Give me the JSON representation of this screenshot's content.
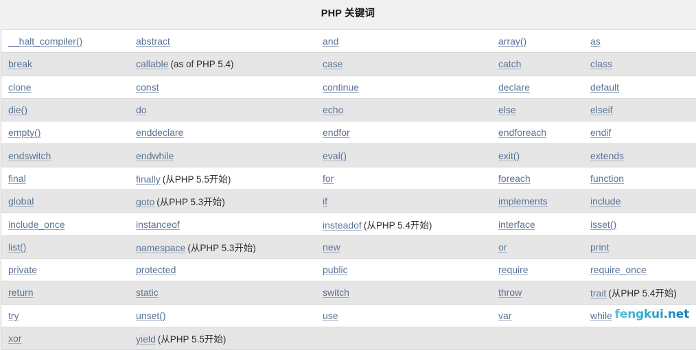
{
  "page": {
    "title": "PHP 关键词",
    "watermark": "fengkui.net",
    "background_color": "#f1f1f1",
    "link_color": "#5b7394",
    "row_alt_color": "#e6e6e6",
    "watermark_color": "#1b8fc4"
  },
  "table": {
    "columns": 5,
    "rows": [
      [
        {
          "keyword": "__halt_compiler()",
          "note": ""
        },
        {
          "keyword": "abstract",
          "note": ""
        },
        {
          "keyword": "and",
          "note": ""
        },
        {
          "keyword": "array()",
          "note": ""
        },
        {
          "keyword": "as",
          "note": ""
        }
      ],
      [
        {
          "keyword": "break",
          "note": ""
        },
        {
          "keyword": "callable",
          "note": "(as of PHP 5.4)"
        },
        {
          "keyword": "case",
          "note": ""
        },
        {
          "keyword": "catch",
          "note": ""
        },
        {
          "keyword": "class",
          "note": ""
        }
      ],
      [
        {
          "keyword": "clone",
          "note": ""
        },
        {
          "keyword": "const",
          "note": ""
        },
        {
          "keyword": "continue",
          "note": ""
        },
        {
          "keyword": "declare",
          "note": ""
        },
        {
          "keyword": "default",
          "note": ""
        }
      ],
      [
        {
          "keyword": "die()",
          "note": ""
        },
        {
          "keyword": "do",
          "note": ""
        },
        {
          "keyword": "echo",
          "note": ""
        },
        {
          "keyword": "else",
          "note": ""
        },
        {
          "keyword": "elseif",
          "note": ""
        }
      ],
      [
        {
          "keyword": "empty()",
          "note": ""
        },
        {
          "keyword": "enddeclare",
          "note": ""
        },
        {
          "keyword": "endfor",
          "note": ""
        },
        {
          "keyword": "endforeach",
          "note": ""
        },
        {
          "keyword": "endif",
          "note": ""
        }
      ],
      [
        {
          "keyword": "endswitch",
          "note": ""
        },
        {
          "keyword": "endwhile",
          "note": ""
        },
        {
          "keyword": "eval()",
          "note": ""
        },
        {
          "keyword": "exit()",
          "note": ""
        },
        {
          "keyword": "extends",
          "note": ""
        }
      ],
      [
        {
          "keyword": "final",
          "note": ""
        },
        {
          "keyword": "finally",
          "note": "(从PHP 5.5开始)"
        },
        {
          "keyword": "for",
          "note": ""
        },
        {
          "keyword": "foreach",
          "note": ""
        },
        {
          "keyword": "function",
          "note": ""
        }
      ],
      [
        {
          "keyword": "global",
          "note": ""
        },
        {
          "keyword": "goto",
          "note": "(从PHP 5.3开始)"
        },
        {
          "keyword": "if",
          "note": ""
        },
        {
          "keyword": "implements",
          "note": ""
        },
        {
          "keyword": "include",
          "note": ""
        }
      ],
      [
        {
          "keyword": "include_once",
          "note": ""
        },
        {
          "keyword": "instanceof",
          "note": ""
        },
        {
          "keyword": "insteadof",
          "note": "(从PHP 5.4开始)"
        },
        {
          "keyword": "interface",
          "note": ""
        },
        {
          "keyword": "isset()",
          "note": ""
        }
      ],
      [
        {
          "keyword": "list()",
          "note": ""
        },
        {
          "keyword": "namespace",
          "note": "(从PHP 5.3开始)"
        },
        {
          "keyword": "new",
          "note": ""
        },
        {
          "keyword": "or",
          "note": ""
        },
        {
          "keyword": "print",
          "note": ""
        }
      ],
      [
        {
          "keyword": "private",
          "note": ""
        },
        {
          "keyword": "protected",
          "note": ""
        },
        {
          "keyword": "public",
          "note": ""
        },
        {
          "keyword": "require",
          "note": ""
        },
        {
          "keyword": "require_once",
          "note": ""
        }
      ],
      [
        {
          "keyword": "return",
          "note": ""
        },
        {
          "keyword": "static",
          "note": ""
        },
        {
          "keyword": "switch",
          "note": ""
        },
        {
          "keyword": "throw",
          "note": ""
        },
        {
          "keyword": "trait",
          "note": "(从PHP 5.4开始)"
        }
      ],
      [
        {
          "keyword": "try",
          "note": ""
        },
        {
          "keyword": "unset()",
          "note": ""
        },
        {
          "keyword": "use",
          "note": ""
        },
        {
          "keyword": "var",
          "note": ""
        },
        {
          "keyword": "while",
          "note": ""
        }
      ],
      [
        {
          "keyword": "xor",
          "note": ""
        },
        {
          "keyword": "yield",
          "note": "(从PHP 5.5开始)"
        },
        {
          "keyword": "",
          "note": ""
        },
        {
          "keyword": "",
          "note": ""
        },
        {
          "keyword": "",
          "note": ""
        }
      ]
    ]
  }
}
